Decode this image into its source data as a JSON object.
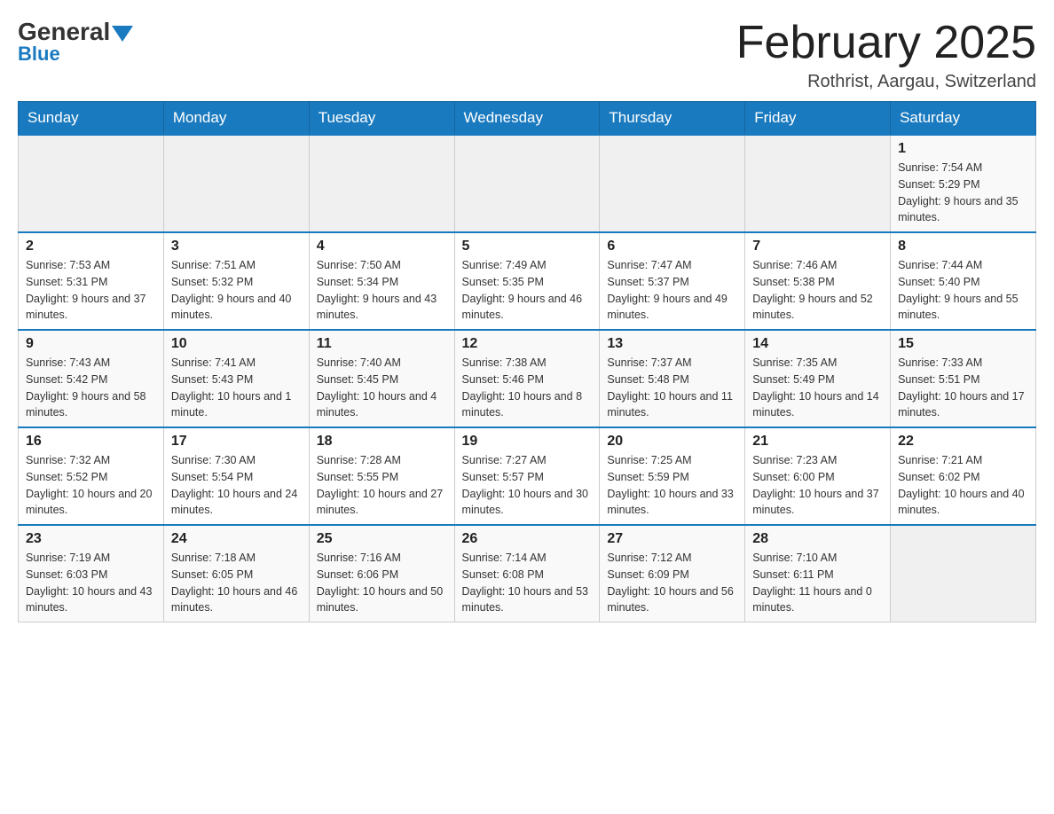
{
  "logo": {
    "general": "General",
    "blue": "Blue"
  },
  "title": "February 2025",
  "location": "Rothrist, Aargau, Switzerland",
  "days_of_week": [
    "Sunday",
    "Monday",
    "Tuesday",
    "Wednesday",
    "Thursday",
    "Friday",
    "Saturday"
  ],
  "weeks": [
    [
      {
        "day": "",
        "info": ""
      },
      {
        "day": "",
        "info": ""
      },
      {
        "day": "",
        "info": ""
      },
      {
        "day": "",
        "info": ""
      },
      {
        "day": "",
        "info": ""
      },
      {
        "day": "",
        "info": ""
      },
      {
        "day": "1",
        "info": "Sunrise: 7:54 AM\nSunset: 5:29 PM\nDaylight: 9 hours and 35 minutes."
      }
    ],
    [
      {
        "day": "2",
        "info": "Sunrise: 7:53 AM\nSunset: 5:31 PM\nDaylight: 9 hours and 37 minutes."
      },
      {
        "day": "3",
        "info": "Sunrise: 7:51 AM\nSunset: 5:32 PM\nDaylight: 9 hours and 40 minutes."
      },
      {
        "day": "4",
        "info": "Sunrise: 7:50 AM\nSunset: 5:34 PM\nDaylight: 9 hours and 43 minutes."
      },
      {
        "day": "5",
        "info": "Sunrise: 7:49 AM\nSunset: 5:35 PM\nDaylight: 9 hours and 46 minutes."
      },
      {
        "day": "6",
        "info": "Sunrise: 7:47 AM\nSunset: 5:37 PM\nDaylight: 9 hours and 49 minutes."
      },
      {
        "day": "7",
        "info": "Sunrise: 7:46 AM\nSunset: 5:38 PM\nDaylight: 9 hours and 52 minutes."
      },
      {
        "day": "8",
        "info": "Sunrise: 7:44 AM\nSunset: 5:40 PM\nDaylight: 9 hours and 55 minutes."
      }
    ],
    [
      {
        "day": "9",
        "info": "Sunrise: 7:43 AM\nSunset: 5:42 PM\nDaylight: 9 hours and 58 minutes."
      },
      {
        "day": "10",
        "info": "Sunrise: 7:41 AM\nSunset: 5:43 PM\nDaylight: 10 hours and 1 minute."
      },
      {
        "day": "11",
        "info": "Sunrise: 7:40 AM\nSunset: 5:45 PM\nDaylight: 10 hours and 4 minutes."
      },
      {
        "day": "12",
        "info": "Sunrise: 7:38 AM\nSunset: 5:46 PM\nDaylight: 10 hours and 8 minutes."
      },
      {
        "day": "13",
        "info": "Sunrise: 7:37 AM\nSunset: 5:48 PM\nDaylight: 10 hours and 11 minutes."
      },
      {
        "day": "14",
        "info": "Sunrise: 7:35 AM\nSunset: 5:49 PM\nDaylight: 10 hours and 14 minutes."
      },
      {
        "day": "15",
        "info": "Sunrise: 7:33 AM\nSunset: 5:51 PM\nDaylight: 10 hours and 17 minutes."
      }
    ],
    [
      {
        "day": "16",
        "info": "Sunrise: 7:32 AM\nSunset: 5:52 PM\nDaylight: 10 hours and 20 minutes."
      },
      {
        "day": "17",
        "info": "Sunrise: 7:30 AM\nSunset: 5:54 PM\nDaylight: 10 hours and 24 minutes."
      },
      {
        "day": "18",
        "info": "Sunrise: 7:28 AM\nSunset: 5:55 PM\nDaylight: 10 hours and 27 minutes."
      },
      {
        "day": "19",
        "info": "Sunrise: 7:27 AM\nSunset: 5:57 PM\nDaylight: 10 hours and 30 minutes."
      },
      {
        "day": "20",
        "info": "Sunrise: 7:25 AM\nSunset: 5:59 PM\nDaylight: 10 hours and 33 minutes."
      },
      {
        "day": "21",
        "info": "Sunrise: 7:23 AM\nSunset: 6:00 PM\nDaylight: 10 hours and 37 minutes."
      },
      {
        "day": "22",
        "info": "Sunrise: 7:21 AM\nSunset: 6:02 PM\nDaylight: 10 hours and 40 minutes."
      }
    ],
    [
      {
        "day": "23",
        "info": "Sunrise: 7:19 AM\nSunset: 6:03 PM\nDaylight: 10 hours and 43 minutes."
      },
      {
        "day": "24",
        "info": "Sunrise: 7:18 AM\nSunset: 6:05 PM\nDaylight: 10 hours and 46 minutes."
      },
      {
        "day": "25",
        "info": "Sunrise: 7:16 AM\nSunset: 6:06 PM\nDaylight: 10 hours and 50 minutes."
      },
      {
        "day": "26",
        "info": "Sunrise: 7:14 AM\nSunset: 6:08 PM\nDaylight: 10 hours and 53 minutes."
      },
      {
        "day": "27",
        "info": "Sunrise: 7:12 AM\nSunset: 6:09 PM\nDaylight: 10 hours and 56 minutes."
      },
      {
        "day": "28",
        "info": "Sunrise: 7:10 AM\nSunset: 6:11 PM\nDaylight: 11 hours and 0 minutes."
      },
      {
        "day": "",
        "info": ""
      }
    ]
  ]
}
